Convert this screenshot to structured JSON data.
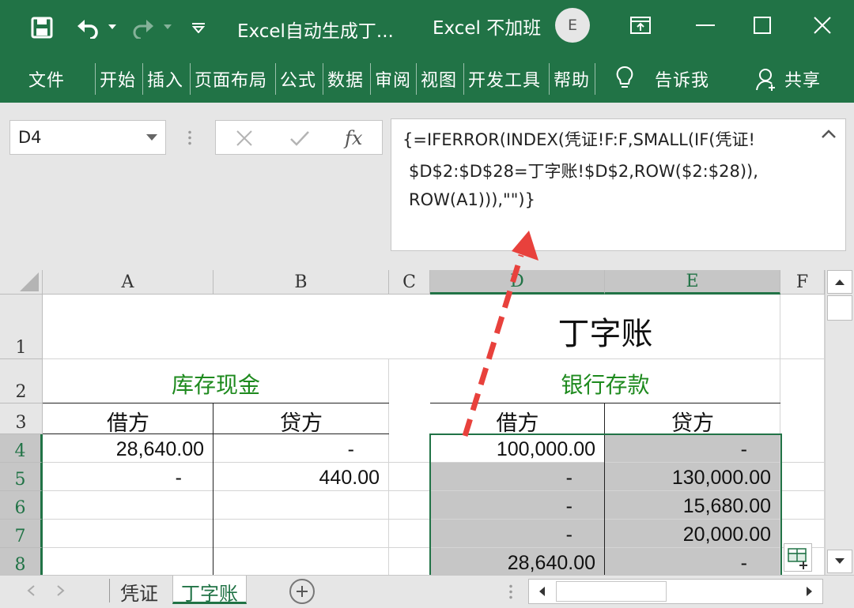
{
  "window": {
    "doc_title": "Excel自动生成丁...",
    "app_name": "Excel 不加班",
    "avatar_initial": "E"
  },
  "ribbon": {
    "tabs": [
      "文件",
      "开始",
      "插入",
      "页面布局",
      "公式",
      "数据",
      "审阅",
      "视图",
      "开发工具",
      "帮助"
    ],
    "tell_me": "告诉我",
    "share": "共享"
  },
  "formula_bar": {
    "name_box": "D4",
    "formula_lines": [
      "{=IFERROR(INDEX(凭证!F:F,SMALL(IF(凭证!",
      "$D$2:$D$28=丁字账!$D$2,ROW($2:$28)),",
      "ROW(A1))),\"\")}"
    ]
  },
  "grid": {
    "columns": [
      "A",
      "B",
      "C",
      "D",
      "E",
      "F"
    ],
    "rows": [
      "1",
      "2",
      "3",
      "4",
      "5",
      "6",
      "7",
      "8"
    ],
    "selected_column_headers": [
      "D",
      "E"
    ],
    "selected_row_headers": [
      "4",
      "5",
      "6",
      "7",
      "8"
    ],
    "title": "丁字账",
    "left_section": {
      "header": "库存现金",
      "debit_label": "借方",
      "credit_label": "贷方",
      "rows": [
        {
          "debit": "28,640.00",
          "credit": "-"
        },
        {
          "debit": "-",
          "credit": "440.00"
        }
      ]
    },
    "right_section": {
      "header": "银行存款",
      "debit_label": "借方",
      "credit_label": "贷方",
      "rows": [
        {
          "debit": "100,000.00",
          "credit": "-"
        },
        {
          "debit": "-",
          "credit": "130,000.00"
        },
        {
          "debit": "-",
          "credit": "15,680.00"
        },
        {
          "debit": "-",
          "credit": "20,000.00"
        },
        {
          "debit": "28,640.00",
          "credit": "-"
        }
      ]
    }
  },
  "sheet_tabs": [
    {
      "label": "凭证",
      "active": false
    },
    {
      "label": "丁字账",
      "active": true
    }
  ],
  "colors": {
    "excel_green": "#217346",
    "header_green_text": "#1e8a1e",
    "selection_fill": "#c6c6c6",
    "arrow_red": "#e8413c"
  },
  "icons": {
    "save": "save-icon",
    "undo": "undo-icon",
    "redo": "redo-icon",
    "customize": "customize-qat-icon",
    "ribbon_display": "ribbon-display-icon",
    "minimize": "minimize-icon",
    "maximize": "maximize-icon",
    "close": "close-icon",
    "lightbulb": "lightbulb-icon",
    "user": "user-icon",
    "cancel": "cancel-icon",
    "enter": "enter-icon",
    "fx": "fx-icon",
    "quick_analysis": "quick-analysis-icon",
    "add_sheet": "add-sheet-icon"
  }
}
